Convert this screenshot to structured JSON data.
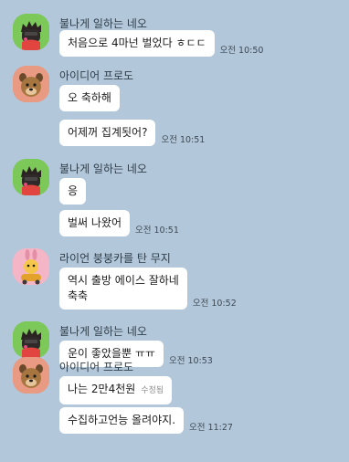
{
  "messages": [
    {
      "sender": "불나게 일하는 네오",
      "avatar": "neo",
      "bubbles": [
        {
          "text": "처음으로 4마넌 벌었다 ㅎㄷㄷ",
          "time": "오전 10:50"
        }
      ]
    },
    {
      "sender": "아이디어 프로도",
      "avatar": "frodo",
      "bubbles": [
        {
          "text": "오 축하해",
          "time": ""
        },
        {
          "text": "어제꺼 집계됫어?",
          "time": "오전 10:51"
        }
      ]
    },
    {
      "sender": "불나게 일하는 네오",
      "avatar": "neo",
      "bubbles": [
        {
          "text": "응",
          "time": ""
        },
        {
          "text": "벌써 나왔어",
          "time": "오전 10:51"
        }
      ]
    },
    {
      "sender": "라이언 붕붕카를 탄 무지",
      "avatar": "muzi",
      "bubbles": [
        {
          "text": "역시 출방 에이스 잘하네\n축축",
          "time": "오전 10:52"
        }
      ]
    },
    {
      "sender": "불나게 일하는 네오",
      "avatar": "neo",
      "bubbles": [
        {
          "text": "운이 좋았을뿐 ㅠㅠ",
          "time": "오전 10:53"
        }
      ]
    },
    {
      "sender": "아이디어 프로도",
      "avatar": "frodo",
      "bubbles": [
        {
          "text": "나는 2만4천원",
          "edited": "수정됨",
          "time": ""
        },
        {
          "text": "수집하고언능 올려야지.",
          "time": "오전 11:27"
        }
      ]
    }
  ]
}
